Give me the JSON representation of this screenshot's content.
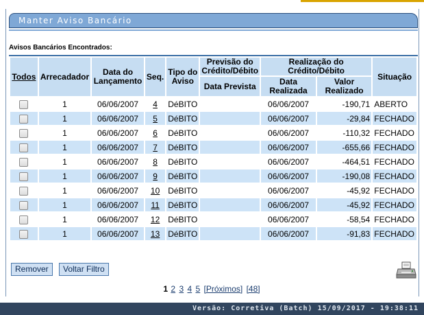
{
  "page": {
    "title": "Manter Aviso Bancário",
    "section_label": "Avisos Bancários Encontrados:"
  },
  "table": {
    "headers": {
      "todos": "Todos",
      "arrecadador": "Arrecadador",
      "data_lancamento": "Data do Lançamento",
      "seq": "Seq.",
      "tipo_aviso": "Tipo do Aviso",
      "previsao": "Previsão do Crédito/Débito",
      "data_prevista": "Data Prevista",
      "realizacao": "Realização do Crédito/Débito",
      "data_realizada": "Data Realizada",
      "valor_realizado": "Valor Realizado",
      "situacao": "Situação"
    },
    "rows": [
      {
        "arrecadador": "1",
        "data_lancamento": "06/06/2007",
        "seq": "4",
        "tipo": "DéBITO",
        "data_prevista": "",
        "data_realizada": "06/06/2007",
        "valor": "-190,71",
        "situacao": "ABERTO"
      },
      {
        "arrecadador": "1",
        "data_lancamento": "06/06/2007",
        "seq": "5",
        "tipo": "DéBITO",
        "data_prevista": "",
        "data_realizada": "06/06/2007",
        "valor": "-29,84",
        "situacao": "FECHADO"
      },
      {
        "arrecadador": "1",
        "data_lancamento": "06/06/2007",
        "seq": "6",
        "tipo": "DéBITO",
        "data_prevista": "",
        "data_realizada": "06/06/2007",
        "valor": "-110,32",
        "situacao": "FECHADO"
      },
      {
        "arrecadador": "1",
        "data_lancamento": "06/06/2007",
        "seq": "7",
        "tipo": "DéBITO",
        "data_prevista": "",
        "data_realizada": "06/06/2007",
        "valor": "-655,66",
        "situacao": "FECHADO"
      },
      {
        "arrecadador": "1",
        "data_lancamento": "06/06/2007",
        "seq": "8",
        "tipo": "DéBITO",
        "data_prevista": "",
        "data_realizada": "06/06/2007",
        "valor": "-464,51",
        "situacao": "FECHADO"
      },
      {
        "arrecadador": "1",
        "data_lancamento": "06/06/2007",
        "seq": "9",
        "tipo": "DéBITO",
        "data_prevista": "",
        "data_realizada": "06/06/2007",
        "valor": "-190,08",
        "situacao": "FECHADO"
      },
      {
        "arrecadador": "1",
        "data_lancamento": "06/06/2007",
        "seq": "10",
        "tipo": "DéBITO",
        "data_prevista": "",
        "data_realizada": "06/06/2007",
        "valor": "-45,92",
        "situacao": "FECHADO"
      },
      {
        "arrecadador": "1",
        "data_lancamento": "06/06/2007",
        "seq": "11",
        "tipo": "DéBITO",
        "data_prevista": "",
        "data_realizada": "06/06/2007",
        "valor": "-45,92",
        "situacao": "FECHADO"
      },
      {
        "arrecadador": "1",
        "data_lancamento": "06/06/2007",
        "seq": "12",
        "tipo": "DéBITO",
        "data_prevista": "",
        "data_realizada": "06/06/2007",
        "valor": "-58,54",
        "situacao": "FECHADO"
      },
      {
        "arrecadador": "1",
        "data_lancamento": "06/06/2007",
        "seq": "13",
        "tipo": "DéBITO",
        "data_prevista": "",
        "data_realizada": "06/06/2007",
        "valor": "-91,83",
        "situacao": "FECHADO"
      }
    ]
  },
  "buttons": {
    "remover": "Remover",
    "voltar_filtro": "Voltar Filtro"
  },
  "printer_icon": "printer-icon",
  "pager": {
    "current": "1",
    "pages": [
      "2",
      "3",
      "4",
      "5"
    ],
    "next": "[Próximos]",
    "last": "[48]"
  },
  "footer": {
    "version": "Versão: Corretiva (Batch) 15/09/2017 - 19:38:11"
  },
  "colors": {
    "header_bg": "#c6ddf2",
    "row_alt_bg": "#cde3f7",
    "title_bg": "#7fa8d6",
    "footer_bg": "#31455e",
    "accent": "#d9a400"
  }
}
